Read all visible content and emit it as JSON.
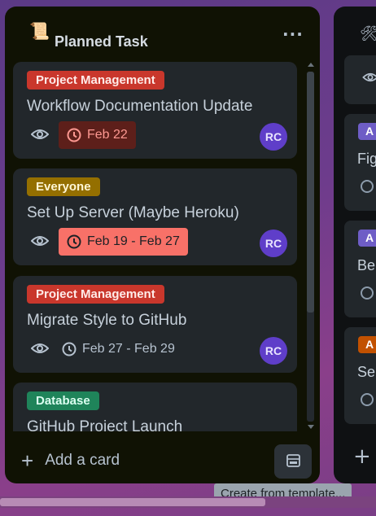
{
  "main_list": {
    "emoji": "📜",
    "title": "Planned Task",
    "menu": "···",
    "cards": [
      {
        "label": "Project Management",
        "label_bg": "#c9372c",
        "label_fg": "#ffece9",
        "title": "Workflow Documentation Update",
        "date": "Feb 22",
        "date_bg": "#5d1f1a",
        "date_fg": "#fd9891",
        "date_icon": "clock-icon",
        "avatar": "RC"
      },
      {
        "label": "Everyone",
        "label_bg": "#946f00",
        "label_fg": "#fff7d6",
        "title": "Set Up Server (Maybe Heroku)",
        "date": "Feb 19 - Feb 27",
        "date_bg": "#f87168",
        "date_fg": "#1d2125",
        "date_icon": "clock-icon",
        "avatar": "RC"
      },
      {
        "label": "Project Management",
        "label_bg": "#c9372c",
        "label_fg": "#ffece9",
        "title": "Migrate Style to GitHub",
        "date": "Feb 27 - Feb 29",
        "date_bg": "transparent",
        "date_fg": "#b6c2cf",
        "date_icon": "clock-icon",
        "avatar": "RC"
      },
      {
        "label": "Database",
        "label_bg": "#1f845a",
        "label_fg": "#dcfff1",
        "title": "GitHub Project Launch"
      }
    ],
    "add_card": "Add a card",
    "template_tooltip": "Create from template..."
  },
  "second_list": {
    "emoji": "🛠",
    "cards": [
      {
        "label": "A",
        "label_bg": "#6e5dc6",
        "title": "Fig"
      },
      {
        "label": "A",
        "label_bg": "#6e5dc6",
        "title": "Be"
      },
      {
        "label": "A",
        "label_bg": "#c25100",
        "title": "Se"
      }
    ]
  },
  "colors": {
    "avatar": "#5f3ec9",
    "list_bg": "#0f1113",
    "card_bg": "#22272b"
  }
}
